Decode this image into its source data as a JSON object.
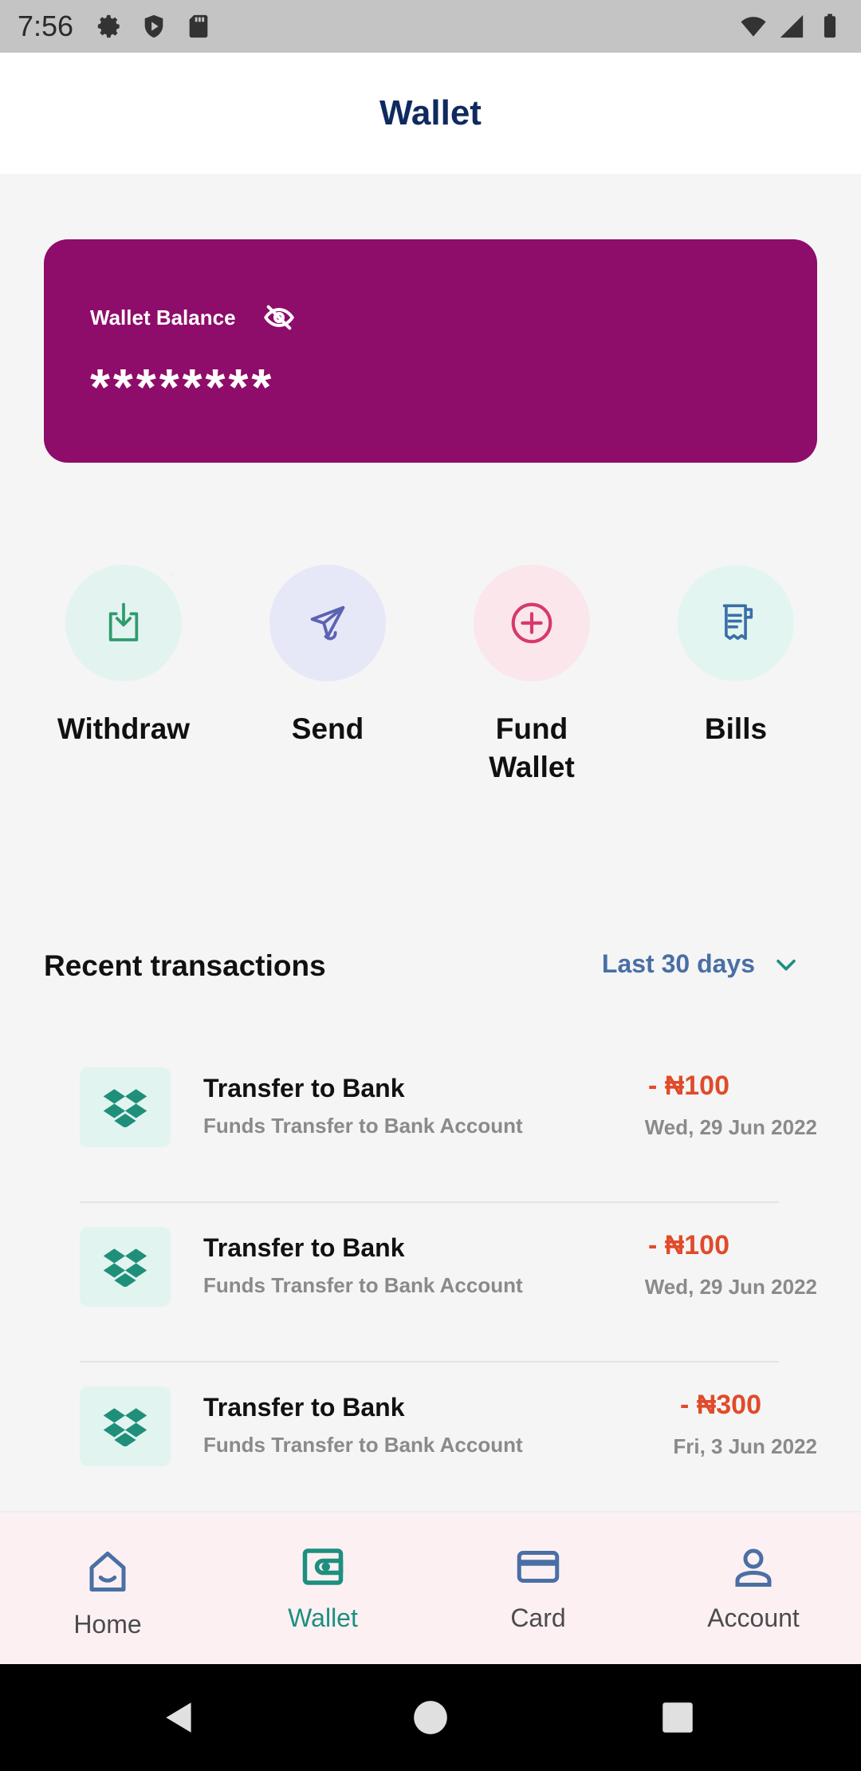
{
  "status_bar": {
    "time": "7:56"
  },
  "header": {
    "title": "Wallet"
  },
  "balance_card": {
    "label": "Wallet Balance",
    "value": "********",
    "background": "#8e0c6a",
    "visibility_icon": "eye-off-icon"
  },
  "actions": [
    {
      "label": "Withdraw",
      "icon": "download-icon",
      "bg": "#e3f3f0",
      "color": "#2e9b6d"
    },
    {
      "label": "Send",
      "icon": "send-icon",
      "bg": "#e6e8f7",
      "color": "#5c62b3"
    },
    {
      "label": "Fund\nWallet",
      "icon": "plus-circle-icon",
      "bg": "#fbe6ec",
      "color": "#d63a6b"
    },
    {
      "label": "Bills",
      "icon": "receipt-icon",
      "bg": "#e3f5f0",
      "color": "#3a6fa8"
    }
  ],
  "recent": {
    "title": "Recent transactions",
    "filter": "Last 30 days"
  },
  "transactions": [
    {
      "title": "Transfer to Bank",
      "subtitle": "Funds Transfer to Bank Account",
      "amount": "- ₦100",
      "date": "Wed, 29 Jun 2022"
    },
    {
      "title": "Transfer to Bank",
      "subtitle": "Funds Transfer to Bank Account",
      "amount": "- ₦100",
      "date": "Wed, 29 Jun 2022"
    },
    {
      "title": "Transfer to Bank",
      "subtitle": "Funds Transfer to Bank Account",
      "amount": "- ₦300",
      "date": "Fri, 3 Jun 2022"
    }
  ],
  "bottom_nav": [
    {
      "label": "Home",
      "icon": "home-icon"
    },
    {
      "label": "Wallet",
      "icon": "wallet-icon",
      "active": true
    },
    {
      "label": "Card",
      "icon": "card-icon"
    },
    {
      "label": "Account",
      "icon": "account-icon"
    }
  ],
  "colors": {
    "accent": "#1d8f7f",
    "title": "#0f2a5f",
    "debit": "#e04b2a"
  }
}
